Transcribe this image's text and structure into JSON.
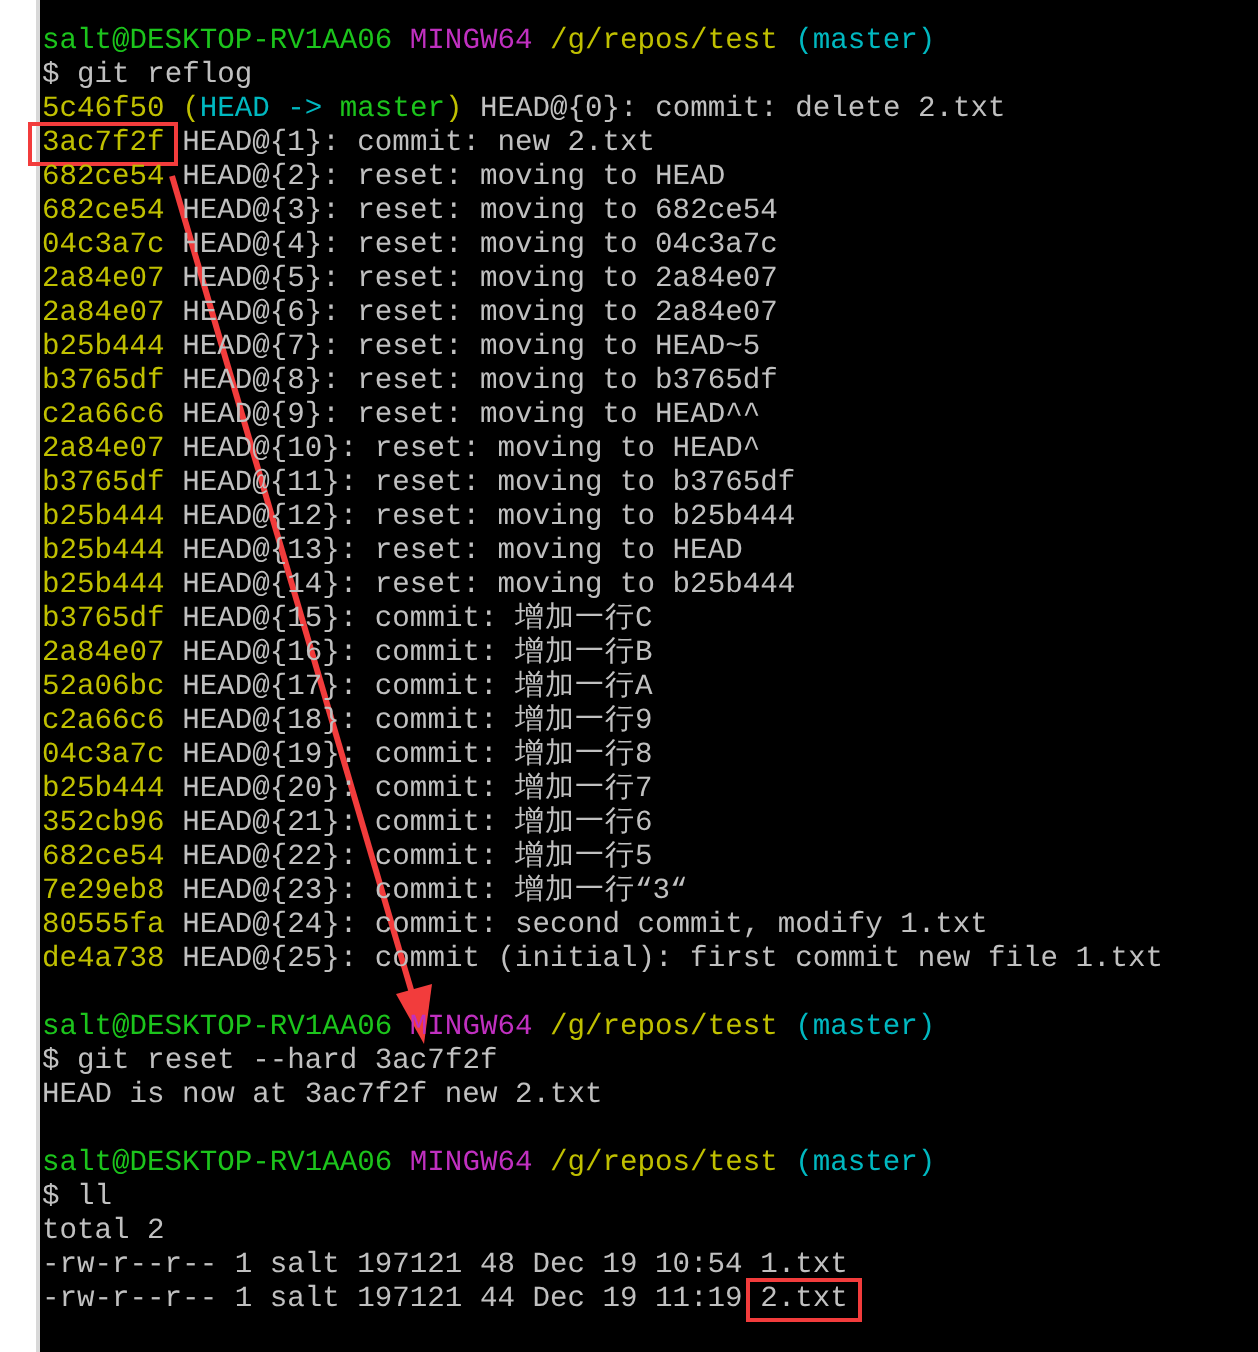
{
  "terminal": {
    "lines": [
      {
        "kind": "prompt",
        "user_host": "salt@DESKTOP-RV1AA06",
        "shell": "MINGW64",
        "path": "/g/repos/test",
        "branch": "(master)"
      },
      {
        "kind": "command",
        "prompt": "$",
        "text": "git reflog"
      },
      {
        "kind": "reflog",
        "hash": "5c46f50",
        "highlighted": false,
        "decoration": {
          "open": "(",
          "head": "HEAD",
          "arrow": "->",
          "branch": "master",
          "close": ")"
        },
        "selector": "HEAD@{0}:",
        "message": "commit: delete 2.txt"
      },
      {
        "kind": "reflog",
        "hash": "3ac7f2f",
        "highlighted": true,
        "selector": "HEAD@{1}:",
        "message": "commit: new 2.txt"
      },
      {
        "kind": "reflog",
        "hash": "682ce54",
        "highlighted": false,
        "selector": "HEAD@{2}:",
        "message": "reset: moving to HEAD"
      },
      {
        "kind": "reflog",
        "hash": "682ce54",
        "highlighted": false,
        "selector": "HEAD@{3}:",
        "message": "reset: moving to 682ce54"
      },
      {
        "kind": "reflog",
        "hash": "04c3a7c",
        "highlighted": false,
        "selector": "HEAD@{4}:",
        "message": "reset: moving to 04c3a7c"
      },
      {
        "kind": "reflog",
        "hash": "2a84e07",
        "highlighted": false,
        "selector": "HEAD@{5}:",
        "message": "reset: moving to 2a84e07"
      },
      {
        "kind": "reflog",
        "hash": "2a84e07",
        "highlighted": false,
        "selector": "HEAD@{6}:",
        "message": "reset: moving to 2a84e07"
      },
      {
        "kind": "reflog",
        "hash": "b25b444",
        "highlighted": false,
        "selector": "HEAD@{7}:",
        "message": "reset: moving to HEAD~5"
      },
      {
        "kind": "reflog",
        "hash": "b3765df",
        "highlighted": false,
        "selector": "HEAD@{8}:",
        "message": "reset: moving to b3765df"
      },
      {
        "kind": "reflog",
        "hash": "c2a66c6",
        "highlighted": false,
        "selector": "HEAD@{9}:",
        "message": "reset: moving to HEAD^^"
      },
      {
        "kind": "reflog",
        "hash": "2a84e07",
        "highlighted": false,
        "selector": "HEAD@{10}:",
        "message": "reset: moving to HEAD^"
      },
      {
        "kind": "reflog",
        "hash": "b3765df",
        "highlighted": false,
        "selector": "HEAD@{11}:",
        "message": "reset: moving to b3765df"
      },
      {
        "kind": "reflog",
        "hash": "b25b444",
        "highlighted": false,
        "selector": "HEAD@{12}:",
        "message": "reset: moving to b25b444"
      },
      {
        "kind": "reflog",
        "hash": "b25b444",
        "highlighted": false,
        "selector": "HEAD@{13}:",
        "message": "reset: moving to HEAD"
      },
      {
        "kind": "reflog",
        "hash": "b25b444",
        "highlighted": false,
        "selector": "HEAD@{14}:",
        "message": "reset: moving to b25b444"
      },
      {
        "kind": "reflog",
        "hash": "b3765df",
        "highlighted": false,
        "selector": "HEAD@{15}:",
        "message": "commit: 增加一行C"
      },
      {
        "kind": "reflog",
        "hash": "2a84e07",
        "highlighted": false,
        "selector": "HEAD@{16}:",
        "message": "commit: 增加一行B"
      },
      {
        "kind": "reflog",
        "hash": "52a06bc",
        "highlighted": false,
        "selector": "HEAD@{17}:",
        "message": "commit: 增加一行A"
      },
      {
        "kind": "reflog",
        "hash": "c2a66c6",
        "highlighted": false,
        "selector": "HEAD@{18}:",
        "message": "commit: 增加一行9"
      },
      {
        "kind": "reflog",
        "hash": "04c3a7c",
        "highlighted": false,
        "selector": "HEAD@{19}:",
        "message": "commit: 增加一行8"
      },
      {
        "kind": "reflog",
        "hash": "b25b444",
        "highlighted": false,
        "selector": "HEAD@{20}:",
        "message": "commit: 增加一行7"
      },
      {
        "kind": "reflog",
        "hash": "352cb96",
        "highlighted": false,
        "selector": "HEAD@{21}:",
        "message": "commit: 增加一行6"
      },
      {
        "kind": "reflog",
        "hash": "682ce54",
        "highlighted": false,
        "selector": "HEAD@{22}:",
        "message": "commit: 增加一行5"
      },
      {
        "kind": "reflog",
        "hash": "7e29eb8",
        "highlighted": false,
        "selector": "HEAD@{23}:",
        "message": "commit: 增加一行“3“"
      },
      {
        "kind": "reflog",
        "hash": "80555fa",
        "highlighted": false,
        "selector": "HEAD@{24}:",
        "message": "commit: second commit, modify 1.txt"
      },
      {
        "kind": "reflog",
        "hash": "de4a738",
        "highlighted": false,
        "selector": "HEAD@{25}:",
        "message": "commit (initial): first commit new file 1.txt"
      },
      {
        "kind": "blank"
      },
      {
        "kind": "prompt",
        "user_host": "salt@DESKTOP-RV1AA06",
        "shell": "MINGW64",
        "path": "/g/repos/test",
        "branch": "(master)"
      },
      {
        "kind": "command",
        "prompt": "$",
        "text": "git reset --hard 3ac7f2f"
      },
      {
        "kind": "output",
        "text": "HEAD is now at 3ac7f2f new 2.txt"
      },
      {
        "kind": "blank"
      },
      {
        "kind": "prompt",
        "user_host": "salt@DESKTOP-RV1AA06",
        "shell": "MINGW64",
        "path": "/g/repos/test",
        "branch": "(master)"
      },
      {
        "kind": "command",
        "prompt": "$",
        "text": "ll"
      },
      {
        "kind": "output",
        "text": "total 2"
      },
      {
        "kind": "file",
        "info": "-rw-r--r-- 1 salt 197121 48 Dec 19 10:54",
        "name": "1.txt",
        "highlighted": false
      },
      {
        "kind": "file",
        "info": "-rw-r--r-- 1 salt 197121 44 Dec 19 11:19",
        "name": "2.txt",
        "highlighted": true
      }
    ]
  },
  "annotation": {
    "arrow": true
  }
}
